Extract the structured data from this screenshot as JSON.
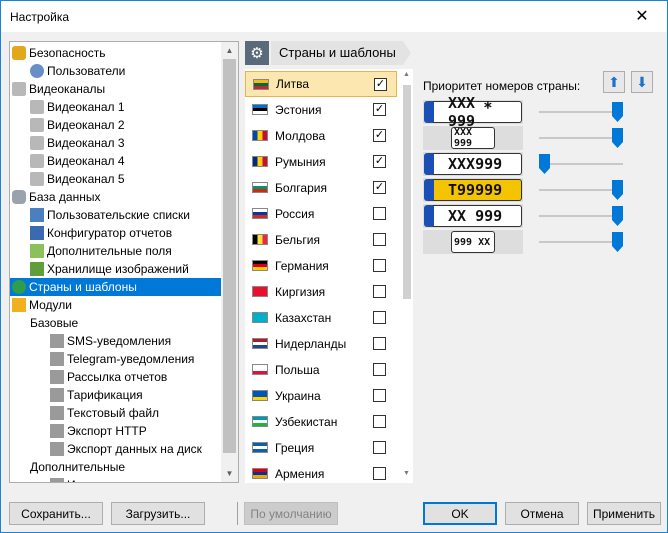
{
  "window": {
    "title": "Настройка"
  },
  "tree": {
    "items": [
      {
        "label": "Безопасность",
        "icon": "lock-icon",
        "indent": 0
      },
      {
        "label": "Пользователи",
        "icon": "users-icon",
        "indent": 1
      },
      {
        "label": "Видеоканалы",
        "icon": "camera-icon",
        "indent": 0
      },
      {
        "label": "Видеоканал 1",
        "icon": "camera-icon",
        "indent": 1
      },
      {
        "label": "Видеоканал 2",
        "icon": "camera-icon",
        "indent": 1
      },
      {
        "label": "Видеоканал 3",
        "icon": "camera-icon",
        "indent": 1
      },
      {
        "label": "Видеоканал 4",
        "icon": "camera-icon",
        "indent": 1
      },
      {
        "label": "Видеоканал 5",
        "icon": "camera-icon",
        "indent": 1
      },
      {
        "label": "База данных",
        "icon": "database-icon",
        "indent": 0
      },
      {
        "label": "Пользовательские списки",
        "icon": "list-icon",
        "indent": 1
      },
      {
        "label": "Конфигуратор отчетов",
        "icon": "report-gear-icon",
        "indent": 1
      },
      {
        "label": "Дополнительные поля",
        "icon": "fields-icon",
        "indent": 1
      },
      {
        "label": "Хранилище изображений",
        "icon": "image-storage-icon",
        "indent": 1
      },
      {
        "label": "Страны и шаблоны",
        "icon": "globe-icon",
        "indent": 0,
        "selected": true
      },
      {
        "label": "Модули",
        "icon": "puzzle-icon",
        "indent": 0
      },
      {
        "label": "Базовые",
        "icon": "",
        "indent": 1
      },
      {
        "label": "SMS-уведомления",
        "icon": "puzzle-gray-icon",
        "indent": 2
      },
      {
        "label": "Telegram-уведомления",
        "icon": "puzzle-gray-icon",
        "indent": 2
      },
      {
        "label": "Рассылка отчетов",
        "icon": "puzzle-gray-icon",
        "indent": 2
      },
      {
        "label": "Тарификация",
        "icon": "puzzle-gray-icon",
        "indent": 2
      },
      {
        "label": "Текстовый файл",
        "icon": "puzzle-gray-icon",
        "indent": 2
      },
      {
        "label": "Экспорт HTTP",
        "icon": "puzzle-gray-icon",
        "indent": 2
      },
      {
        "label": "Экспорт данных на диск",
        "icon": "puzzle-gray-icon",
        "indent": 2
      },
      {
        "label": "Дополнительные",
        "icon": "",
        "indent": 1
      },
      {
        "label": "Измерение скорости",
        "icon": "puzzle-gray-icon",
        "indent": 2
      }
    ]
  },
  "panel": {
    "title": "Страны и шаблоны"
  },
  "countries": [
    {
      "name": "Литва",
      "checked": true,
      "selected": true,
      "flag": [
        "#fdb913",
        "#006a44",
        "#c1272d"
      ]
    },
    {
      "name": "Эстония",
      "checked": true,
      "flag": [
        "#0072ce",
        "#000000",
        "#ffffff"
      ]
    },
    {
      "name": "Молдова",
      "checked": true,
      "flag": [
        "#0046ae",
        "#ffd200",
        "#cc092f"
      ],
      "vertical": true
    },
    {
      "name": "Румыния",
      "checked": true,
      "flag": [
        "#002b7f",
        "#fcd116",
        "#ce1126"
      ],
      "vertical": true
    },
    {
      "name": "Болгария",
      "checked": true,
      "flag": [
        "#ffffff",
        "#00966e",
        "#d62612"
      ]
    },
    {
      "name": "Россия",
      "checked": false,
      "flag": [
        "#ffffff",
        "#0039a6",
        "#d52b1e"
      ]
    },
    {
      "name": "Бельгия",
      "checked": false,
      "flag": [
        "#000000",
        "#fae042",
        "#ed2939"
      ],
      "vertical": true
    },
    {
      "name": "Германия",
      "checked": false,
      "flag": [
        "#000000",
        "#dd0000",
        "#ffce00"
      ]
    },
    {
      "name": "Киргизия",
      "checked": false,
      "flag": [
        "#e8112d",
        "#e8112d",
        "#e8112d"
      ]
    },
    {
      "name": "Казахстан",
      "checked": false,
      "flag": [
        "#00afca",
        "#00afca",
        "#00afca"
      ]
    },
    {
      "name": "Нидерланды",
      "checked": false,
      "flag": [
        "#ae1c28",
        "#ffffff",
        "#21468b"
      ]
    },
    {
      "name": "Польша",
      "checked": false,
      "flag": [
        "#ffffff",
        "#ffffff",
        "#dc143c"
      ]
    },
    {
      "name": "Украина",
      "checked": false,
      "flag": [
        "#0057b7",
        "#0057b7",
        "#ffd700"
      ]
    },
    {
      "name": "Узбекистан",
      "checked": false,
      "flag": [
        "#0099b5",
        "#ffffff",
        "#1eb53a"
      ]
    },
    {
      "name": "Греция",
      "checked": false,
      "flag": [
        "#0d5eaf",
        "#ffffff",
        "#0d5eaf"
      ]
    },
    {
      "name": "Армения",
      "checked": false,
      "flag": [
        "#d90012",
        "#0033a0",
        "#f2a800"
      ]
    }
  ],
  "priority": {
    "label": "Приоритет номеров страны:",
    "up_icon": "arrow-up-icon",
    "down_icon": "arrow-down-icon",
    "plates": [
      {
        "text": "XXX ⁎ 999",
        "bg": "#ffffff",
        "level": 1.0
      },
      {
        "text": "XXX 999",
        "bg": "#ffffff",
        "level": 1.0
      },
      {
        "text": "XXX999",
        "bg": "#ffffff",
        "level": 0.0
      },
      {
        "text": "T99999",
        "bg": "#f5c400",
        "level": 1.0
      },
      {
        "text": "XX  999",
        "bg": "#ffffff",
        "level": 1.0
      },
      {
        "text": "999 XX",
        "bg": "#ffffff",
        "level": 1.0
      }
    ]
  },
  "buttons": {
    "save": "Сохранить...",
    "load": "Загрузить...",
    "defaults": "По умолчанию",
    "ok": "OK",
    "cancel": "Отмена",
    "apply": "Применить"
  }
}
